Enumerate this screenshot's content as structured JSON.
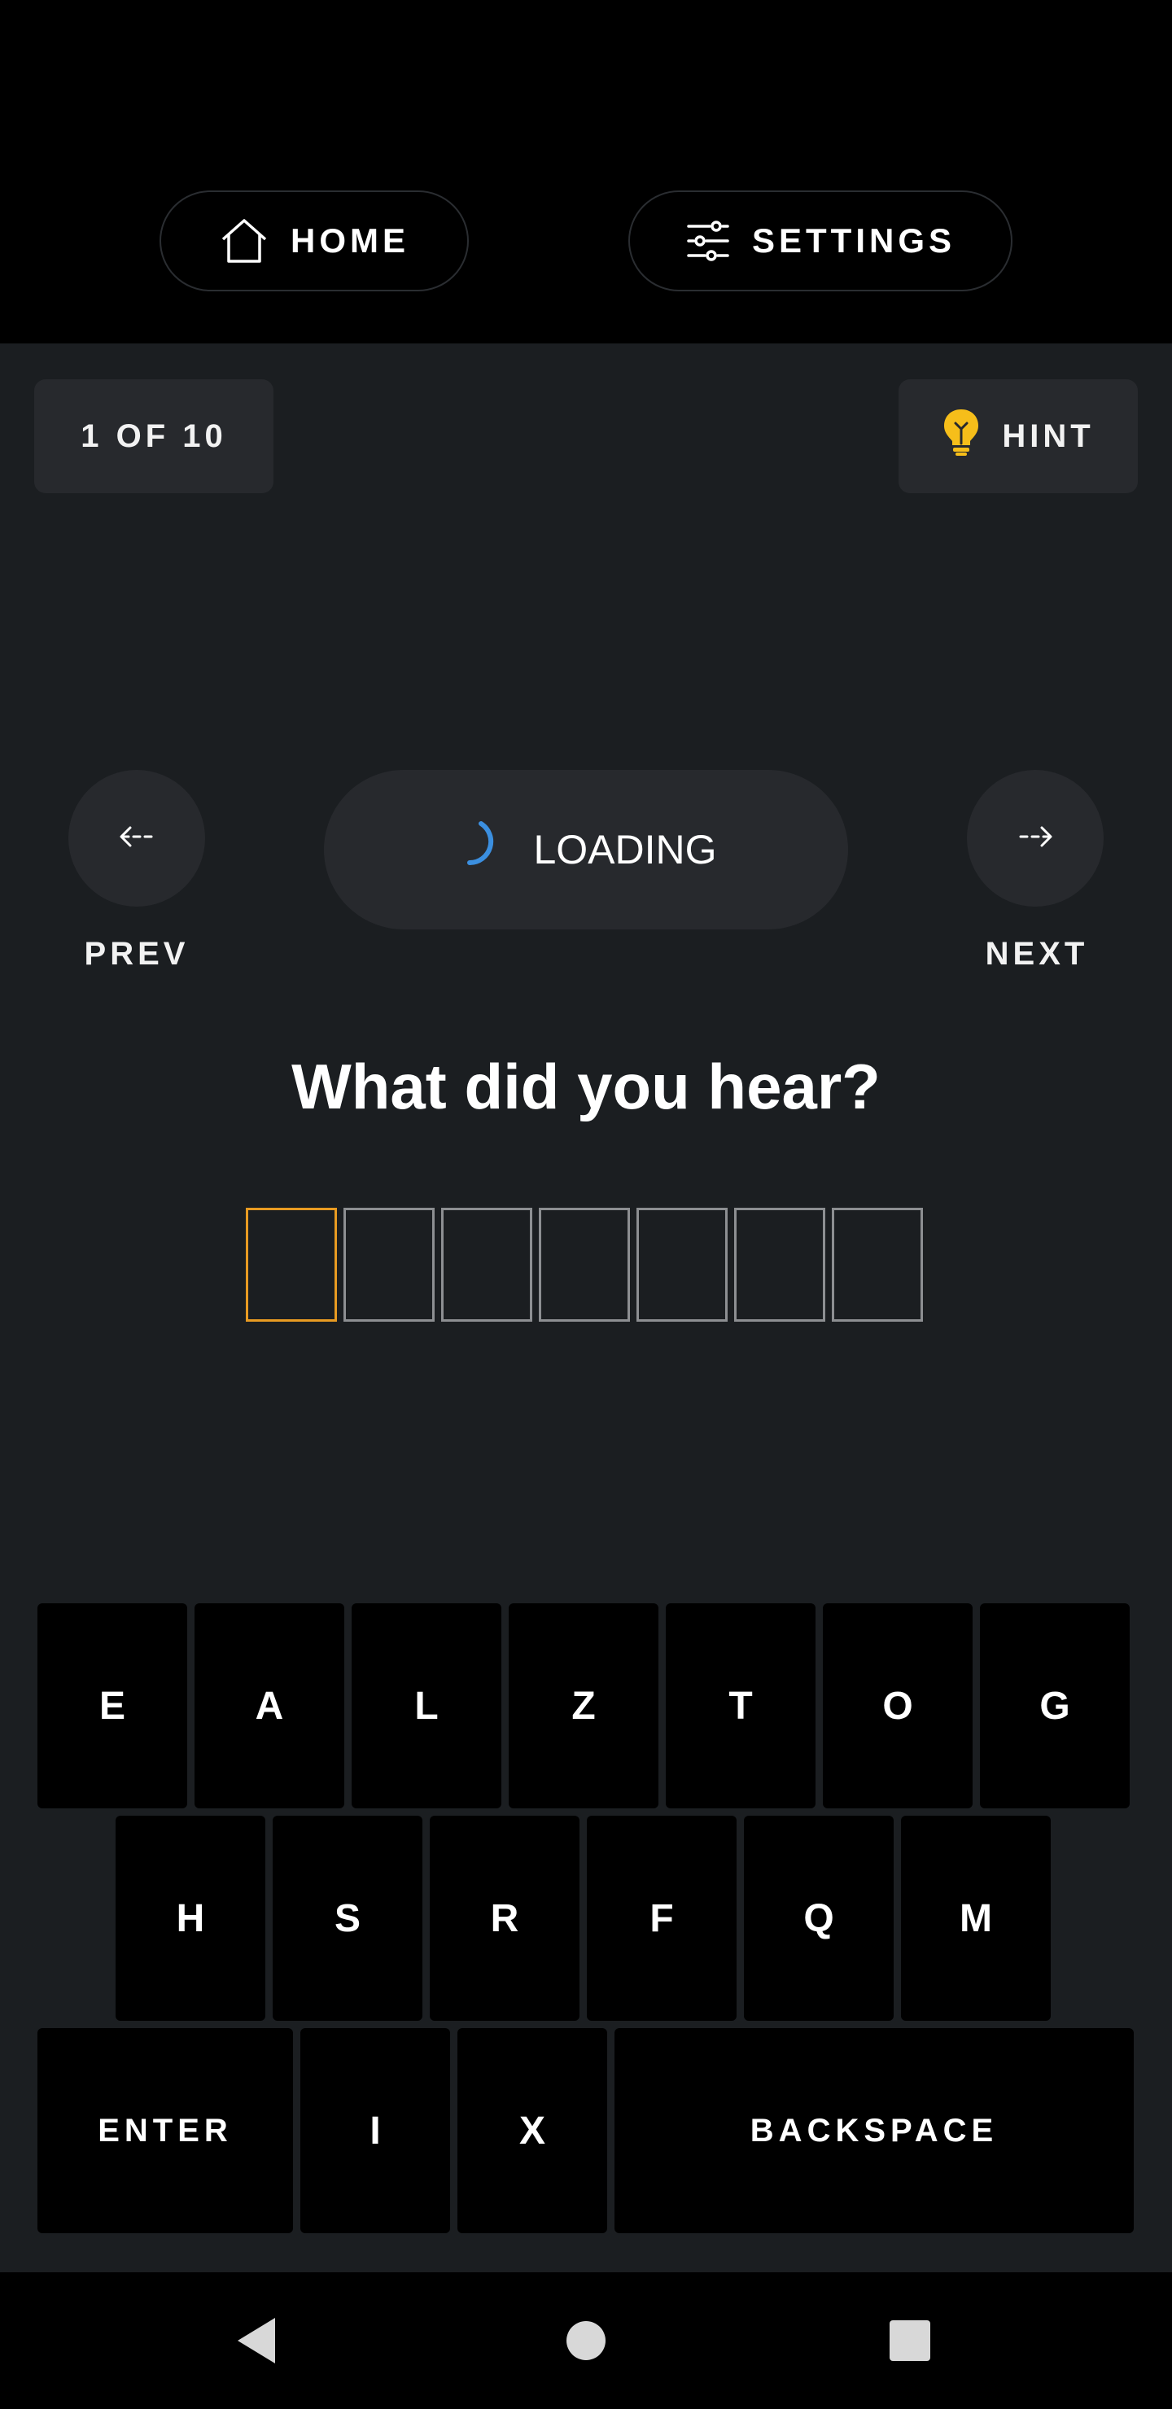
{
  "header": {
    "home_label": "HOME",
    "settings_label": "SETTINGS"
  },
  "game": {
    "counter": "1 OF 10",
    "hint_label": "HINT",
    "prev_label": "PREV",
    "next_label": "NEXT",
    "loading_label": "LOADING",
    "question": "What did you hear?",
    "slot_count": 7,
    "active_slot": 0
  },
  "keyboard": {
    "row1": [
      "E",
      "A",
      "L",
      "Z",
      "T",
      "O",
      "G"
    ],
    "row2": [
      "H",
      "S",
      "R",
      "F",
      "Q",
      "M"
    ],
    "row3": [
      "ENTER",
      "I",
      "X",
      "BACKSPACE"
    ]
  },
  "colors": {
    "background": "#1b1e21",
    "surface": "#27292d",
    "accent_orange": "#e89b22",
    "hint_yellow": "#f6be1a",
    "spinner_blue": "#3b8fe0"
  },
  "icons": {
    "home": "home-icon",
    "settings": "sliders-icon",
    "hint": "lightbulb-icon",
    "prev": "arrow-left-icon",
    "next": "arrow-right-icon",
    "loading": "spinner-icon",
    "sys_back": "back-triangle-icon",
    "sys_home": "home-circle-icon",
    "sys_recents": "recents-square-icon"
  }
}
